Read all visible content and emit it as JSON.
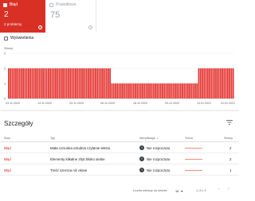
{
  "cards": {
    "errors": {
      "label": "Błąd",
      "value": "2",
      "sublabel": "2 problemy"
    },
    "valid": {
      "label": "Prawidłowe",
      "value": "75"
    },
    "help_glyph": "?"
  },
  "impressions_label": "Wyświetlenia",
  "chart_data": {
    "type": "bar",
    "ylabel": "Strony",
    "yticks": [
      "3",
      "2",
      "1",
      "0"
    ],
    "ylim": [
      0,
      3
    ],
    "xticks": [
      "03.11.2020",
      "14.11.2020",
      "25.11.2020",
      "06.12.2020",
      "18.12.2020",
      "29.12.2020",
      "10.01.2021",
      "21.01.2021"
    ],
    "bar_color": "#e53935",
    "values": [
      2,
      2,
      2,
      2,
      2,
      2,
      2,
      2,
      2,
      2,
      2,
      2,
      2,
      2,
      2,
      2,
      2,
      2,
      2,
      2,
      2,
      2,
      2,
      2,
      2,
      2,
      2,
      2,
      2,
      2,
      2,
      2,
      2,
      2,
      2,
      2,
      2,
      2,
      2,
      2,
      2,
      2,
      2,
      2,
      2,
      2,
      2,
      2,
      2,
      2,
      2,
      2,
      2,
      2,
      2,
      2,
      2,
      1,
      1,
      1,
      1,
      1,
      1,
      1,
      1,
      1,
      1,
      1,
      1,
      1,
      1,
      1,
      1,
      1,
      1,
      1,
      1,
      1,
      1,
      1,
      1,
      1,
      1,
      1,
      1,
      1,
      1,
      1,
      1,
      1,
      1,
      1,
      1,
      1,
      1,
      1,
      1,
      1,
      1,
      1,
      1,
      1,
      1,
      1,
      1,
      2,
      2,
      2,
      2,
      2,
      2,
      2,
      2,
      2,
      2,
      2,
      2,
      2,
      2,
      2,
      2,
      2,
      2,
      2,
      2
    ]
  },
  "details": {
    "title": "Szczegóły",
    "columns": {
      "stan": "Stan",
      "typ": "Typ",
      "weryfikacja": "Weryfikacja",
      "trend": "Trend",
      "strony": "Strony"
    },
    "rows": [
      {
        "stan": "Błąd",
        "typ": "Mała czcionka utrudnia czytanie tekstu",
        "weryfikacja": "Nie rozpoczęto",
        "strony": "2"
      },
      {
        "stan": "Błąd",
        "typ": "Elementy klikalne zbyt blisko siebie",
        "weryfikacja": "Nie rozpoczęto",
        "strony": "2"
      },
      {
        "stan": "Błąd",
        "typ": "Treść szersza niż ekran",
        "weryfikacja": "Nie rozpoczęto",
        "strony": "1"
      }
    ],
    "verif_glyph": "!",
    "pager": {
      "rows_label": "Liczba wierszy na stronie:",
      "rows_value": "10",
      "range": "1–3 z 3",
      "prev": "‹",
      "next": "›"
    }
  }
}
